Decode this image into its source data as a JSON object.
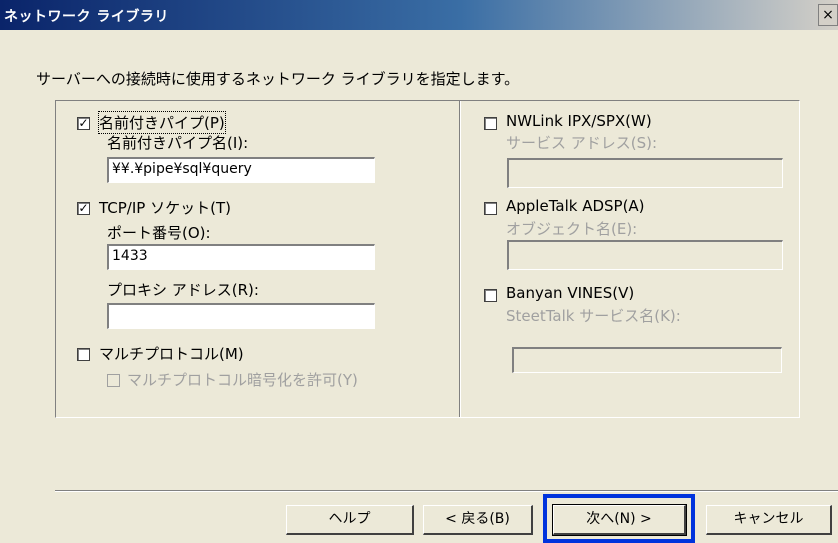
{
  "window": {
    "title": "ネットワーク ライブラリ",
    "close_glyph": "×"
  },
  "instruction": "サーバーへの接続時に使用するネットワーク ライブラリを指定します。",
  "left": {
    "named_pipe": {
      "label": "名前付きパイプ(P)",
      "checked": true,
      "checkmark": "✓",
      "name_label": "名前付きパイプ名(I):",
      "name_value": "¥¥.¥pipe¥sql¥query"
    },
    "tcpip": {
      "label": "TCP/IP ソケット(T)",
      "checked": true,
      "checkmark": "✓",
      "port_label": "ポート番号(O):",
      "port_value": "1433",
      "proxy_label": "プロキシ アドレス(R):",
      "proxy_value": ""
    },
    "multiprotocol": {
      "label": "マルチプロトコル(M)",
      "checked": false,
      "encrypt_label": "マルチプロトコル暗号化を許可(Y)",
      "encrypt_checked": false
    }
  },
  "right": {
    "nwlink": {
      "label": "NWLink IPX/SPX(W)",
      "checked": false,
      "address_label": "サービス アドレス(S):",
      "address_value": ""
    },
    "appletalk": {
      "label": "AppleTalk ADSP(A)",
      "checked": false,
      "object_label": "オブジェクト名(E):",
      "object_value": ""
    },
    "banyan": {
      "label": "Banyan VINES(V)",
      "checked": false,
      "streettalk_label": "SteetTalk サービス名(K):",
      "streettalk_value": ""
    }
  },
  "buttons": {
    "help": "ヘルプ",
    "back": "< 戻る(B)",
    "next": "次へ(N) >",
    "cancel": "キャンセル"
  },
  "colors": {
    "highlight": "#0033dd",
    "dialog_bg": "#ece9d8"
  }
}
